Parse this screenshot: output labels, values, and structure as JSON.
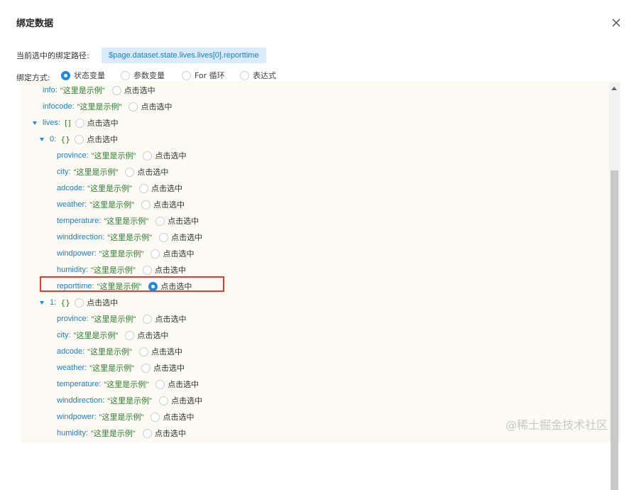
{
  "dialog": {
    "title": "绑定数据",
    "close_icon": "close-icon"
  },
  "path": {
    "label": "当前选中的绑定路径:",
    "value": "$page.dataset.state.lives.lives[0].reporttime"
  },
  "binding_mode": {
    "label": "绑定方式:",
    "options": [
      {
        "label": "状态变量",
        "checked": true
      },
      {
        "label": "参数变量",
        "checked": false
      },
      {
        "label": "For 循环",
        "checked": false
      },
      {
        "label": "表达式",
        "checked": false
      }
    ]
  },
  "tree": {
    "pick_label": "点击选中",
    "sample_value": "\"这里是示例\"",
    "nodes": [
      {
        "key": "info:",
        "value": "\"这里是示例\"",
        "checked": false
      },
      {
        "key": "infocode:",
        "value": "\"这里是示例\"",
        "checked": false
      },
      {
        "key": "lives:",
        "brace": "[]",
        "expanded": true,
        "checked": false
      },
      {
        "key": "0:",
        "brace": "{}",
        "expanded": true,
        "checked": false
      },
      {
        "key": "province:",
        "value": "\"这里是示例\"",
        "checked": false
      },
      {
        "key": "city:",
        "value": "\"这里是示例\"",
        "checked": false
      },
      {
        "key": "adcode:",
        "value": "\"这里是示例\"",
        "checked": false
      },
      {
        "key": "weather:",
        "value": "\"这里是示例\"",
        "checked": false
      },
      {
        "key": "temperature:",
        "value": "\"这里是示例\"",
        "checked": false
      },
      {
        "key": "winddirection:",
        "value": "\"这里是示例\"",
        "checked": false
      },
      {
        "key": "windpower:",
        "value": "\"这里是示例\"",
        "checked": false
      },
      {
        "key": "humidity:",
        "value": "\"这里是示例\"",
        "checked": false
      },
      {
        "key": "reporttime:",
        "value": "\"这里是示例\"",
        "checked": true
      },
      {
        "key": "1:",
        "brace": "{}",
        "expanded": true,
        "checked": false
      },
      {
        "key": "province:",
        "value": "\"这里是示例\"",
        "checked": false
      },
      {
        "key": "city:",
        "value": "\"这里是示例\"",
        "checked": false
      },
      {
        "key": "adcode:",
        "value": "\"这里是示例\"",
        "checked": false
      },
      {
        "key": "weather:",
        "value": "\"这里是示例\"",
        "checked": false
      },
      {
        "key": "temperature:",
        "value": "\"这里是示例\"",
        "checked": false
      },
      {
        "key": "winddirection:",
        "value": "\"这里是示例\"",
        "checked": false
      },
      {
        "key": "windpower:",
        "value": "\"这里是示例\"",
        "checked": false
      },
      {
        "key": "humidity:",
        "value": "\"这里是示例\"",
        "checked": false
      }
    ]
  },
  "watermark": "@稀土掘金技术社区",
  "colors": {
    "accent": "#1e88e5",
    "highlight_border": "#e53935",
    "key": "#1d7ccc",
    "value": "#2f7a32"
  }
}
